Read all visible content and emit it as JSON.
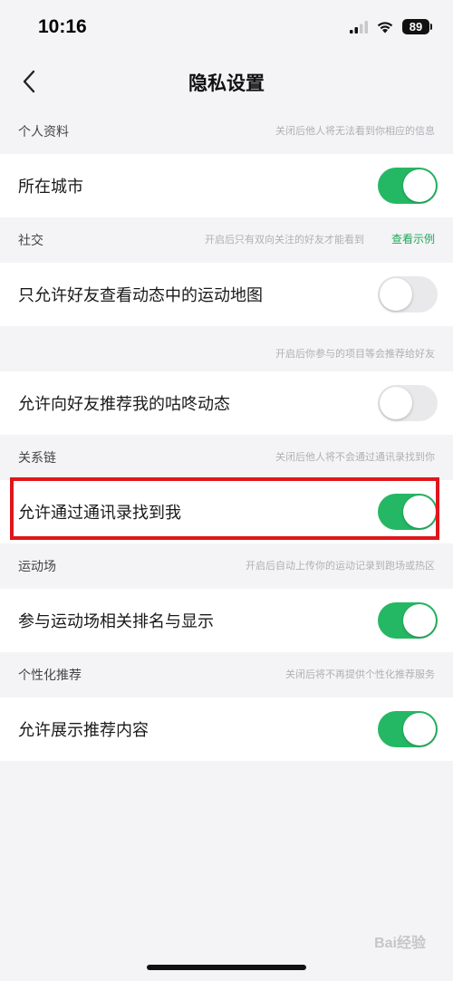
{
  "status_bar": {
    "time": "10:16",
    "battery": "89"
  },
  "nav": {
    "title": "隐私设置"
  },
  "sections": [
    {
      "title": "个人资料",
      "hint": "关闭后他人将无法看到你相应的信息",
      "rows": [
        {
          "label": "所在城市",
          "enabled": true
        }
      ]
    },
    {
      "title": "社交",
      "hint": "开启后只有双向关注的好友才能看到",
      "link": "查看示例",
      "rows": [
        {
          "label": "只允许好友查看动态中的运动地图",
          "enabled": false
        }
      ]
    },
    {
      "title": "",
      "hint": "开启后你参与的项目等会推荐给好友",
      "rows": [
        {
          "label": "允许向好友推荐我的咕咚动态",
          "enabled": false
        }
      ]
    },
    {
      "title": "关系链",
      "hint": "关闭后他人将不会通过通讯录找到你",
      "rows": [
        {
          "label": "允许通过通讯录找到我",
          "enabled": true
        }
      ]
    },
    {
      "title": "运动场",
      "hint": "开启后自动上传你的运动记录到跑场或热区",
      "rows": [
        {
          "label": "参与运动场相关排名与显示",
          "enabled": true
        }
      ]
    },
    {
      "title": "个性化推荐",
      "hint": "关闭后将不再提供个性化推荐服务",
      "rows": [
        {
          "label": "允许展示推荐内容",
          "enabled": true
        }
      ]
    }
  ],
  "colors": {
    "toggle_on": "#25b864",
    "toggle_off": "#e9e9ec",
    "link": "#1fa65a",
    "highlight": "#e0161b",
    "background": "#f4f4f6"
  },
  "watermark": "Bai经验"
}
